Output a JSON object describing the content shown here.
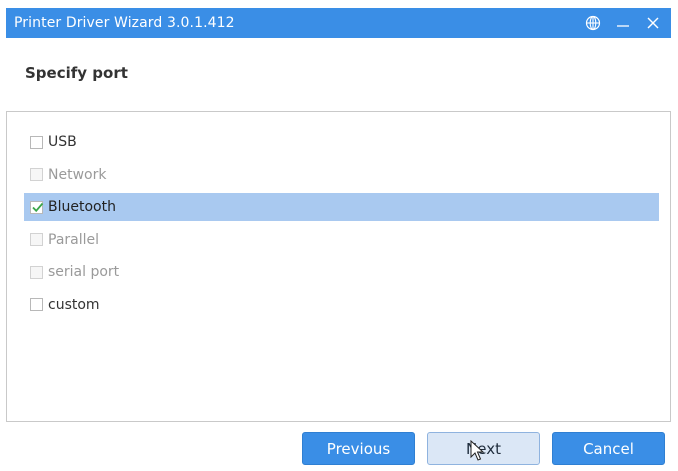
{
  "window": {
    "title": "Printer Driver Wizard 3.0.1.412",
    "controls": [
      {
        "name": "language-globe-icon"
      },
      {
        "name": "minimize-icon"
      },
      {
        "name": "close-icon"
      }
    ]
  },
  "header": {
    "title": "Specify port"
  },
  "ports": [
    {
      "label": "USB",
      "checked": false,
      "enabled": true,
      "selected": false
    },
    {
      "label": "Network",
      "checked": false,
      "enabled": false,
      "selected": false
    },
    {
      "label": "Bluetooth",
      "checked": true,
      "enabled": true,
      "selected": true
    },
    {
      "label": "Parallel",
      "checked": false,
      "enabled": false,
      "selected": false
    },
    {
      "label": "serial port",
      "checked": false,
      "enabled": false,
      "selected": false
    },
    {
      "label": "custom",
      "checked": false,
      "enabled": true,
      "selected": false
    }
  ],
  "buttons": {
    "previous": "Previous",
    "next": "Next",
    "cancel": "Cancel"
  },
  "colors": {
    "accent": "#3a8ee6",
    "selection": "#a9c9f0",
    "check": "#3aa64a"
  }
}
